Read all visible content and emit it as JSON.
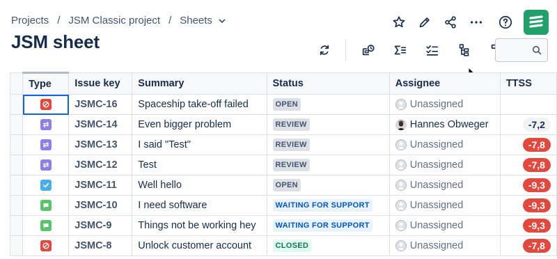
{
  "breadcrumb": {
    "items": [
      "Projects",
      "JSM Classic project",
      "Sheets"
    ],
    "separator": "/"
  },
  "page": {
    "title": "JSM sheet"
  },
  "top_actions": [
    "star-icon",
    "pencil-icon",
    "share-icon",
    "more-icon",
    "help-icon"
  ],
  "app_logo": {
    "color": "#22a06b"
  },
  "toolbar": [
    "refresh-icon",
    "share-view-icon",
    "sum-icon",
    "checklist-icon",
    "hierarchy-icon",
    "format-paint-icon"
  ],
  "search": {
    "value": "",
    "placeholder": ""
  },
  "table": {
    "columns": [
      "Type",
      "Issue key",
      "Summary",
      "Status",
      "Assignee",
      "TTSS"
    ],
    "rows": [
      {
        "type": "incident",
        "key": "JSMC-16",
        "summary": "Spaceship take-off failed",
        "status": "OPEN",
        "status_color": "grey",
        "assignee": "Unassigned",
        "ttss": ""
      },
      {
        "type": "change",
        "key": "JSMC-14",
        "summary": "Even bigger problem",
        "status": "REVIEW",
        "status_color": "grey",
        "assignee": "Hannes Obweger",
        "ttss": "-7,2"
      },
      {
        "type": "change",
        "key": "JSMC-13",
        "summary": "I said \"Test\"",
        "status": "REVIEW",
        "status_color": "grey",
        "assignee": "Unassigned",
        "ttss": "-7,8"
      },
      {
        "type": "change",
        "key": "JSMC-12",
        "summary": "Test",
        "status": "REVIEW",
        "status_color": "grey",
        "assignee": "Unassigned",
        "ttss": "-7,8"
      },
      {
        "type": "task",
        "key": "JSMC-11",
        "summary": "Well hello",
        "status": "OPEN",
        "status_color": "grey",
        "assignee": "Unassigned",
        "ttss": "-9,3"
      },
      {
        "type": "service-request",
        "key": "JSMC-10",
        "summary": "I need software",
        "status": "WAITING FOR SUPPORT",
        "status_color": "blue",
        "assignee": "Unassigned",
        "ttss": "-9,3"
      },
      {
        "type": "service-request",
        "key": "JSMC-9",
        "summary": "Things not be working hey",
        "status": "WAITING FOR SUPPORT",
        "status_color": "blue",
        "assignee": "Unassigned",
        "ttss": "-9,3"
      },
      {
        "type": "incident",
        "key": "JSMC-8",
        "summary": "Unlock customer account",
        "status": "CLOSED",
        "status_color": "green",
        "assignee": "Unassigned",
        "ttss": "-7,8"
      }
    ]
  },
  "colors": {
    "incident": "#e2483d",
    "change": "#8f7ee7",
    "task": "#4bade8",
    "service-request": "#5ac26a",
    "ttss_red": "#e2483d"
  }
}
